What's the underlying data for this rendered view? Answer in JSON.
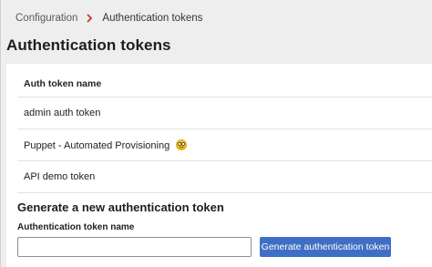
{
  "breadcrumb": {
    "parent": "Configuration",
    "current": "Authentication tokens",
    "separator_icon": "chevron-right-icon",
    "separator_color": "#c0392b"
  },
  "page": {
    "title": "Authentication tokens"
  },
  "tokens_table": {
    "header": "Auth token name",
    "rows": [
      {
        "name": "admin auth token"
      },
      {
        "name": "Puppet - Automated Provisioning",
        "icon": "nerd-face-emoji-icon"
      },
      {
        "name": "API demo token"
      }
    ]
  },
  "generate": {
    "title": "Generate a new authentication token",
    "field_label": "Authentication token name",
    "input_value": "",
    "input_placeholder": "",
    "button_label": "Generate authentication token",
    "button_color": "#3f6fc4"
  }
}
